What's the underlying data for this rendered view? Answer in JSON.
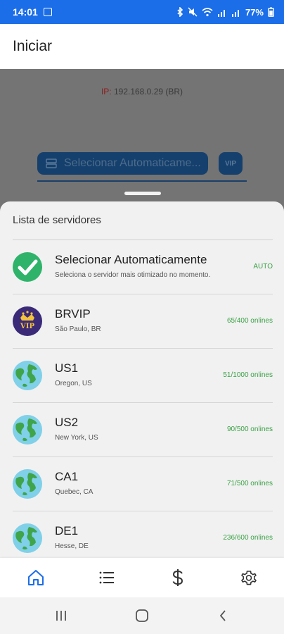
{
  "status_bar": {
    "time": "14:01",
    "battery": "77%"
  },
  "app_bar": {
    "title": "Iniciar"
  },
  "main": {
    "ip_label": "IP:",
    "ip_value": "192.168.0.29 (BR)",
    "server_select_text": "Selecionar Automaticame...",
    "vip_button_label": "VIP"
  },
  "sheet": {
    "title": "Lista de servidores",
    "servers": [
      {
        "name": "Selecionar Automaticamente",
        "subtitle": "Seleciona o servidor mais otimizado no momento.",
        "meta": "AUTO",
        "icon": "check-icon"
      },
      {
        "name": "BRVIP",
        "subtitle": "São Paulo, BR",
        "meta": "65/400 onlines",
        "icon": "vip-crown-icon"
      },
      {
        "name": "US1",
        "subtitle": "Oregon, US",
        "meta": "51/1000 onlines",
        "icon": "globe-icon"
      },
      {
        "name": "US2",
        "subtitle": "New York, US",
        "meta": "90/500 onlines",
        "icon": "globe-icon"
      },
      {
        "name": "CA1",
        "subtitle": "Quebec, CA",
        "meta": "71/500 onlines",
        "icon": "globe-icon"
      },
      {
        "name": "DE1",
        "subtitle": "Hesse, DE",
        "meta": "236/600 onlines",
        "icon": "globe-icon"
      }
    ]
  },
  "colors": {
    "status_bar": "#1b6ee8",
    "accent": "#1b6ee8",
    "online_green": "#3aa245"
  }
}
